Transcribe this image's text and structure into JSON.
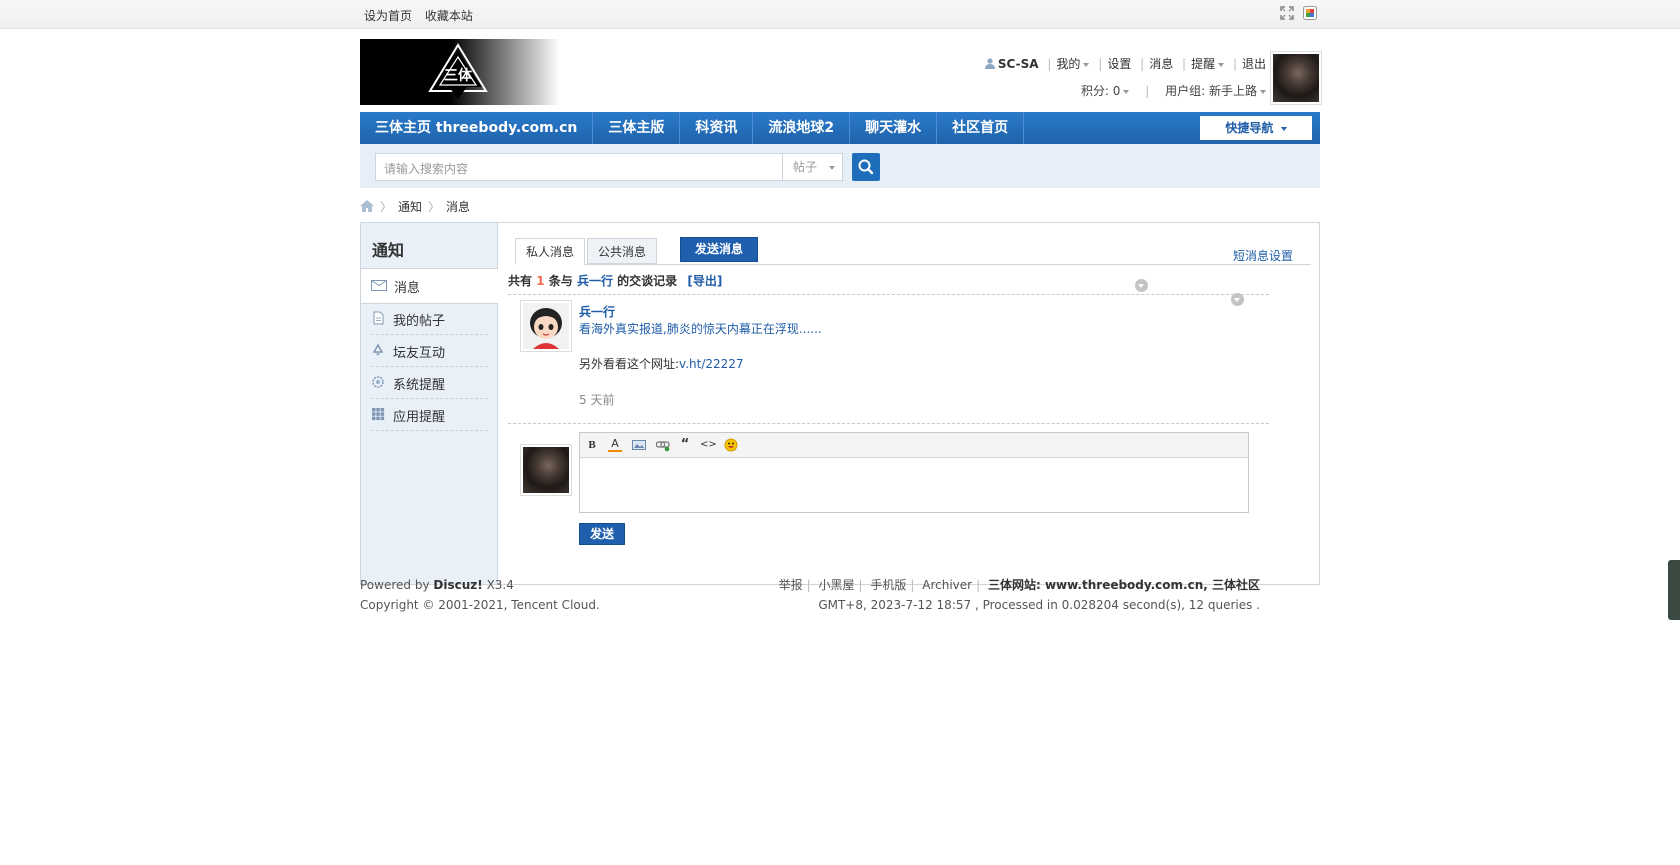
{
  "topbar": {
    "set_home": "设为首页",
    "bookmark": "收藏本站",
    "icons": [
      "fullscreen-icon",
      "palette-icon"
    ]
  },
  "logo": {
    "text": "三体",
    "alt": "logo"
  },
  "user": {
    "name": "SC-SA",
    "my": "我的",
    "settings": "设置",
    "messages": "消息",
    "remind": "提醒",
    "logout": "退出",
    "points": "积分: 0",
    "sep": "|",
    "group": "用户组: 新手上路"
  },
  "nav": {
    "items": [
      "三体主页 threebody.com.cn",
      "三体主版",
      "科资讯",
      "流浪地球2",
      "聊天灌水",
      "社区首页"
    ],
    "quick_nav": "快捷导航"
  },
  "search": {
    "placeholder": "请输入搜索内容",
    "type": "帖子"
  },
  "breadcrumb": [
    "通知",
    "消息"
  ],
  "sidebar": {
    "title": "通知",
    "items": [
      {
        "label": "消息",
        "icon": "mail-icon"
      },
      {
        "label": "我的帖子",
        "icon": "document-icon"
      },
      {
        "label": "坛友互动",
        "icon": "recycle-icon"
      },
      {
        "label": "系统提醒",
        "icon": "gear-icon"
      },
      {
        "label": "应用提醒",
        "icon": "grid-icon"
      }
    ]
  },
  "tabs": {
    "private": "私人消息",
    "public": "公共消息",
    "send": "发送消息",
    "settings": "短消息设置"
  },
  "summary": {
    "prefix": "共有",
    "count": "1",
    "mid": "条与",
    "user": "兵一行",
    "suffix": "的交谈记录",
    "export": "[导出]"
  },
  "message": {
    "author": "兵一行",
    "line1": "看海外真实报道,肺炎的惊天内幕正在浮现......",
    "line2_prefix": "另外看看这个网址:",
    "line2_link": "v.ht/22227",
    "time": "5 天前"
  },
  "editor": {
    "tools": [
      "B",
      "A",
      "image-icon",
      "link-icon",
      "“",
      "<>",
      "emoji-icon"
    ],
    "send": "发送"
  },
  "footer": {
    "powered": "Powered by",
    "discuz": "Discuz!",
    "version": "X3.4",
    "copyright": "Copyright © 2001-2021, Tencent Cloud.",
    "links": [
      "举报",
      "小黑屋",
      "手机版",
      "Archiver"
    ],
    "site": "三体网站: www.threebody.com.cn, 三体社区",
    "stats": "GMT+8, 2023-7-12 18:57 , Processed in 0.028204 second(s), 12 queries ."
  },
  "colors": {
    "nav": "#2a7acb",
    "link": "#1f5da8",
    "accent": "#f26c4f"
  }
}
